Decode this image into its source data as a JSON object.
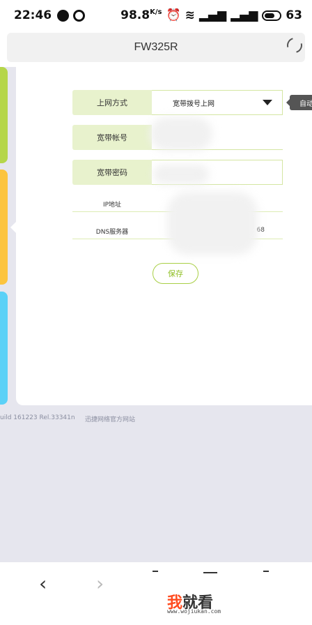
{
  "status_bar": {
    "time": "22:46",
    "speed": "98.8",
    "speed_unit": "K/s",
    "battery": "63"
  },
  "browser": {
    "title": "FW325R"
  },
  "form": {
    "connection_type": {
      "label": "上网方式",
      "value": "宽带拨号上网"
    },
    "tooltip": "自动",
    "account": {
      "label": "宽带帐号"
    },
    "password": {
      "label": "宽带密码"
    },
    "ip": {
      "label": "IP地址"
    },
    "dns": {
      "label": "DNS服务器",
      "value_suffix": "68"
    },
    "save_label": "保存"
  },
  "footer": {
    "build": "uild 161223 Rel.33341n",
    "website": "迅捷网络官方网站"
  },
  "nav": {
    "back": "‹",
    "forward": "›"
  },
  "watermark": {
    "title_a": "我",
    "title_b": "就看",
    "url": "www.wojiukan.com"
  }
}
